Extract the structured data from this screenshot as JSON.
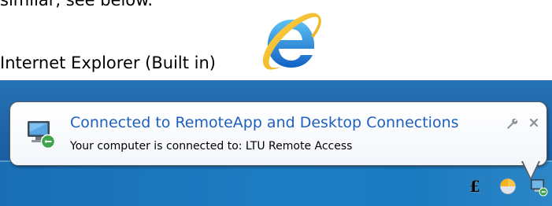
{
  "document": {
    "line1": "similar, see below.",
    "line2": "Internet Explorer (Built in)"
  },
  "icons": {
    "ie_logo": "internet-explorer-logo",
    "balloon": "remote-desktop-connection-icon",
    "options": "wrench-icon",
    "close": "close-icon",
    "tray": [
      "pound-icon",
      "weather-icon",
      "remote-desktop-icon"
    ]
  },
  "notification": {
    "title": "Connected to RemoteApp and Desktop Connections",
    "body": "Your computer is connected to: LTU Remote Access"
  },
  "tray": {
    "pound_glyph": "£"
  },
  "colors": {
    "title": "#1f5fbd",
    "taskbar": "#1d62a7",
    "ie_blue": "#1a7bd6",
    "ie_gold": "#f4b800"
  }
}
